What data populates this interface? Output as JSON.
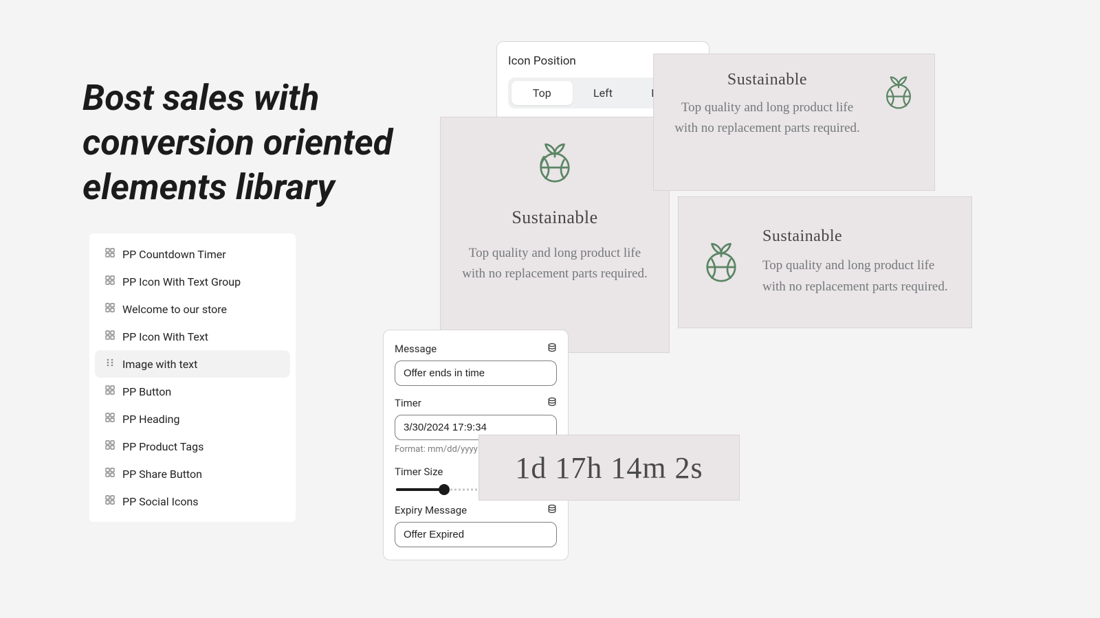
{
  "headline": "Bost sales with conversion oriented elements library",
  "elements_list": [
    {
      "label": "PP Countdown Timer",
      "selected": false
    },
    {
      "label": "PP Icon With Text Group",
      "selected": false
    },
    {
      "label": "Welcome to our store",
      "selected": false
    },
    {
      "label": "PP Icon With Text",
      "selected": false
    },
    {
      "label": "Image with text",
      "selected": true
    },
    {
      "label": "PP Button",
      "selected": false
    },
    {
      "label": "PP Heading",
      "selected": false
    },
    {
      "label": "PP Product Tags",
      "selected": false
    },
    {
      "label": "PP Share Button",
      "selected": false
    },
    {
      "label": "PP Social Icons",
      "selected": false
    }
  ],
  "icon_position": {
    "label": "Icon Position",
    "options": [
      "Top",
      "Left",
      "Right"
    ],
    "active": "Top"
  },
  "sustainable": {
    "title": "Sustainable",
    "desc": "Top quality and long product life with no replacement parts required."
  },
  "settings": {
    "message": {
      "label": "Message",
      "value": "Offer ends in time"
    },
    "timer": {
      "label": "Timer",
      "value": "3/30/2024 17:9:34",
      "format_hint": "Format: mm/dd/yyyy"
    },
    "timer_size": {
      "label": "Timer Size",
      "percent": 30
    },
    "expiry": {
      "label": "Expiry Message",
      "value": "Offer Expired"
    }
  },
  "countdown_display": "1d 17h 14m 2s"
}
